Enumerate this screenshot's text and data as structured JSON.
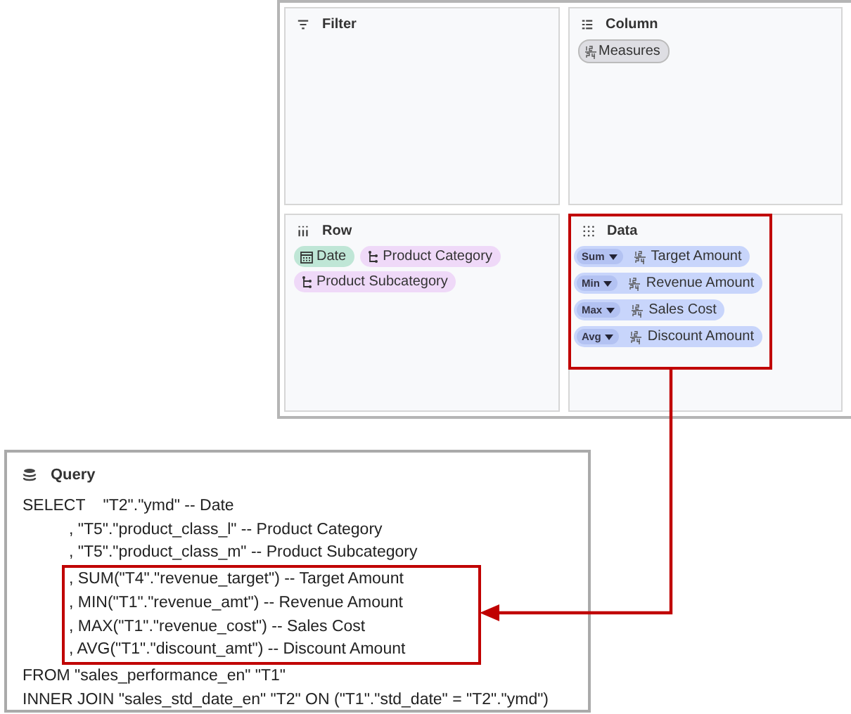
{
  "shelves": {
    "filter": {
      "title": "Filter"
    },
    "column": {
      "title": "Column",
      "items": [
        {
          "label": "Measures"
        }
      ]
    },
    "row": {
      "title": "Row",
      "items": [
        {
          "label": "Date",
          "kind": "date"
        },
        {
          "label": "Product Category",
          "kind": "hierarchy"
        },
        {
          "label": "Product Subcategory",
          "kind": "hierarchy"
        }
      ]
    },
    "data": {
      "title": "Data",
      "items": [
        {
          "aggregation": "Sum",
          "label": "Target Amount"
        },
        {
          "aggregation": "Min",
          "label": "Revenue Amount"
        },
        {
          "aggregation": "Max",
          "label": "Sales Cost"
        },
        {
          "aggregation": "Avg",
          "label": "Discount Amount"
        }
      ]
    }
  },
  "query": {
    "title": "Query",
    "lines_before": [
      {
        "text": "SELECT    \"T2\".\"ymd\" -- Date",
        "kind": "clause"
      },
      {
        "text": ", \"T5\".\"product_class_l\" -- Product Category",
        "kind": "continuation"
      },
      {
        "text": ", \"T5\".\"product_class_m\" -- Product Subcategory",
        "kind": "continuation"
      }
    ],
    "highlighted_lines": [
      {
        "text": ", SUM(\"T4\".\"revenue_target\") -- Target Amount"
      },
      {
        "text": ", MIN(\"T1\".\"revenue_amt\") -- Revenue Amount"
      },
      {
        "text": ", MAX(\"T1\".\"revenue_cost\") -- Sales Cost"
      },
      {
        "text": ", AVG(\"T1\".\"discount_amt\") -- Discount Amount"
      }
    ],
    "lines_after": [
      {
        "text": "FROM \"sales_performance_en\" \"T1\"",
        "kind": "clause"
      },
      {
        "text": "INNER JOIN \"sales_std_date_en\" \"T2\" ON (\"T1\".\"std_date\" = \"T2\".\"ymd\")",
        "kind": "clause"
      }
    ]
  }
}
